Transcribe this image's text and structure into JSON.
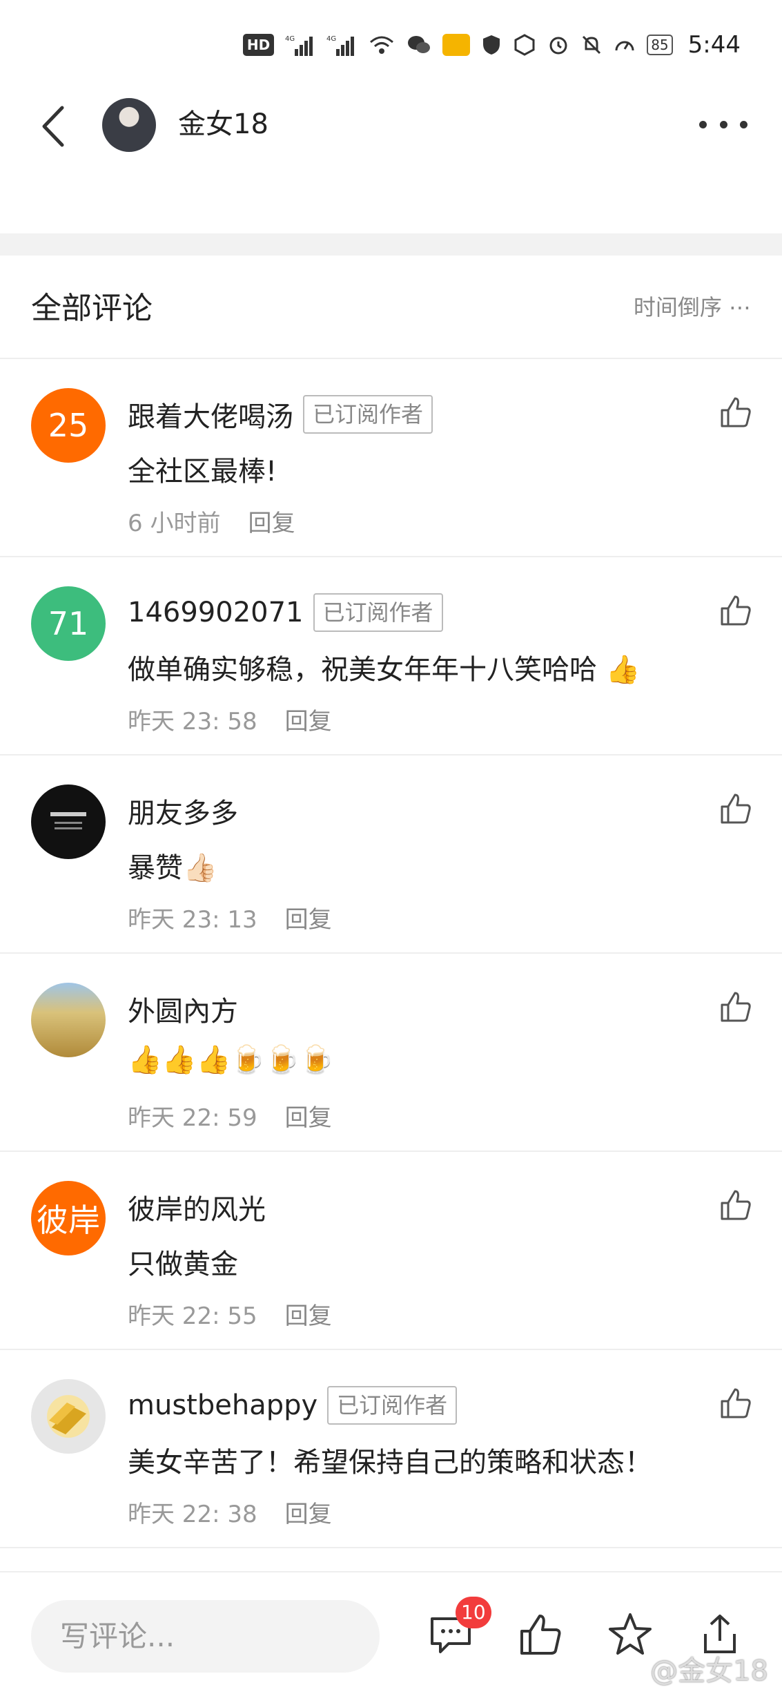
{
  "status_bar": {
    "hd_label": "HD",
    "network_label": "4G",
    "battery": "85",
    "time": "5:44",
    "colors": {
      "message_badge": "#f5b400"
    }
  },
  "header": {
    "title": "金女18",
    "back_icon": "chevron-left-icon",
    "more_icon": "more-horizontal-icon"
  },
  "comments_section": {
    "title": "全部评论",
    "sort_label": "时间倒序 ⋯"
  },
  "comments": [
    {
      "avatar_text": "25",
      "avatar_color": "#ff6a00",
      "name": "跟着大佬喝汤",
      "badge": "已订阅作者",
      "text": "全社区最棒!",
      "time": "6 小时前",
      "reply": "回复"
    },
    {
      "avatar_text": "71",
      "avatar_color": "#3dbd7d",
      "name": "1469902071",
      "badge": "已订阅作者",
      "text": "做单确实够稳，祝美女年年十八笑哈哈 👍",
      "time": "昨天 23: 58",
      "reply": "回复"
    },
    {
      "avatar_text": "",
      "avatar_color": "#111111",
      "name": "朋友多多",
      "badge": "",
      "text": "暴赞👍🏻",
      "time": "昨天 23: 13",
      "reply": "回复"
    },
    {
      "avatar_text": "",
      "avatar_color": "#c8a85a",
      "name": "外圆內方",
      "badge": "",
      "text": "👍👍👍🍺🍺🍺",
      "time": "昨天 22: 59",
      "reply": "回复"
    },
    {
      "avatar_text": "彼岸",
      "avatar_color": "#ff6a00",
      "name": "彼岸的风光",
      "badge": "",
      "text": "只做黄金",
      "time": "昨天 22: 55",
      "reply": "回复"
    },
    {
      "avatar_text": "",
      "avatar_color": "#f0d58a",
      "name": "mustbehappy",
      "badge": "已订阅作者",
      "text": "美女辛苦了！希望保持自己的策略和状态！",
      "time": "昨天 22: 38",
      "reply": "回复"
    }
  ],
  "bottom_bar": {
    "write_placeholder": "写评论...",
    "comment_count": "10",
    "watermark": "@金女18"
  }
}
